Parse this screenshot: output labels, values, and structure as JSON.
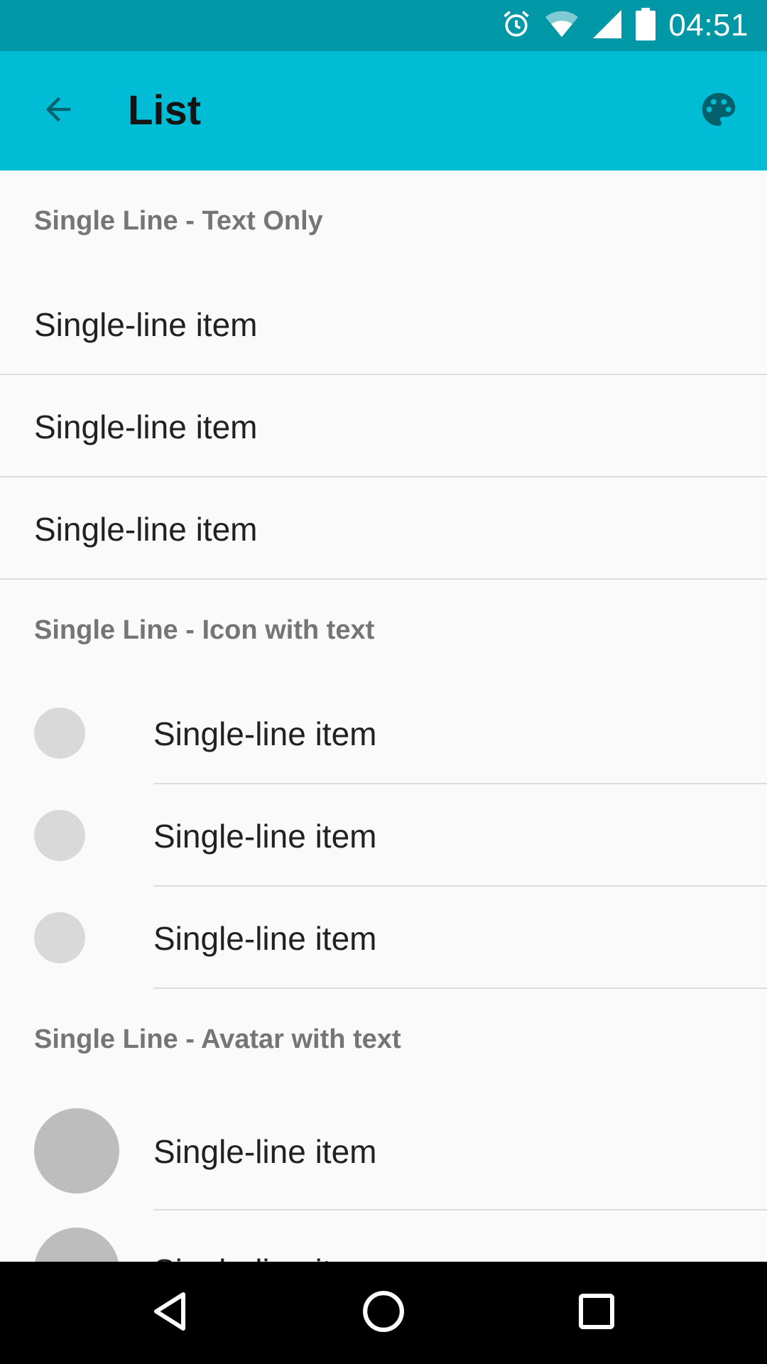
{
  "status_bar": {
    "time": "04:51",
    "icons": [
      "alarm-icon",
      "wifi-icon",
      "cell-signal-icon",
      "battery-icon"
    ]
  },
  "toolbar": {
    "title": "List",
    "back_icon": "arrow-back-icon",
    "action_icon": "palette-icon",
    "colors": {
      "toolbar": "#00bcd4",
      "status_bar": "#0097a7"
    }
  },
  "sections": [
    {
      "header": "Single Line - Text Only",
      "items": [
        "Single-line item",
        "Single-line item",
        "Single-line item"
      ]
    },
    {
      "header": "Single Line - Icon with text",
      "items": [
        "Single-line item",
        "Single-line item",
        "Single-line item"
      ]
    },
    {
      "header": "Single Line - Avatar with text",
      "items": [
        "Single-line item",
        "Single-line item"
      ]
    }
  ],
  "nav_bar": {
    "buttons": [
      "back-triangle-icon",
      "home-circle-icon",
      "recents-square-icon"
    ]
  }
}
